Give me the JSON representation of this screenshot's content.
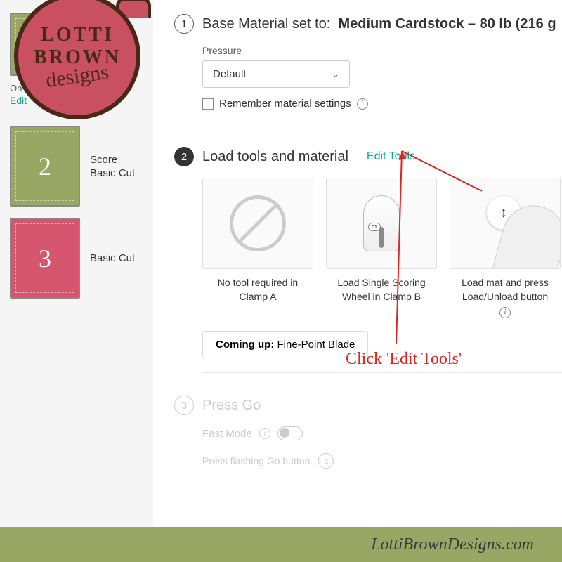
{
  "sidebar": {
    "top_hint": "On M... Off",
    "edit": "Edit",
    "mats": [
      {
        "num": "2",
        "line1": "Score",
        "line2": "Basic Cut"
      },
      {
        "num": "3",
        "line1": "Basic Cut",
        "line2": ""
      }
    ]
  },
  "step1": {
    "num": "1",
    "title_prefix": "Base Material set to:",
    "title_value": "Medium Cardstock – 80 lb (216 g",
    "pressure_label": "Pressure",
    "pressure_value": "Default",
    "remember": "Remember material settings"
  },
  "step2": {
    "num": "2",
    "title": "Load tools and material",
    "edit_tools": "Edit Tools",
    "cards": [
      "No tool required in Clamp A",
      "Load Single Scoring Wheel in Clamp B",
      "Load mat and press Load/Unload button"
    ],
    "badge": "01",
    "coming_label": "Coming up:",
    "coming_value": "Fine-Point Blade"
  },
  "step3": {
    "num": "3",
    "title": "Press Go",
    "fast_mode": "Fast Mode",
    "press_text": "Press flashing Go button.",
    "go_glyph": "c"
  },
  "annotation": {
    "text": "Click 'Edit Tools'"
  },
  "logo": {
    "line1": "LOTTI",
    "line2": "BROWN",
    "line3": "designs"
  },
  "footer": {
    "text": "LottiBrownDesigns.com"
  }
}
